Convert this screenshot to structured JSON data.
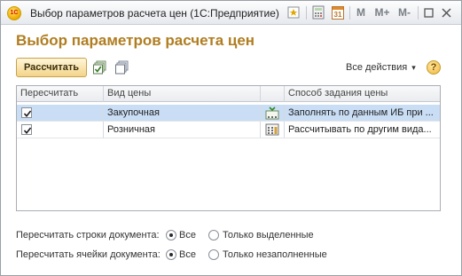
{
  "window": {
    "title": "Выбор параметров расчета цен",
    "app_name": "(1С:Предприятие)",
    "logo_text": "1С",
    "toolbar": {
      "calendar_day": "31",
      "mem_m": "M",
      "mem_m_plus": "M+",
      "mem_m_minus": "M-",
      "minimize": "_",
      "maximize": "□",
      "close": "✕"
    }
  },
  "page": {
    "title": "Выбор параметров расчета цен"
  },
  "toolbar": {
    "calculate_label": "Рассчитать",
    "all_actions_label": "Все действия",
    "all_actions_arrow": "▾",
    "help_label": "?"
  },
  "table": {
    "columns": {
      "recalc": "Пересчитать",
      "price_type": "Вид цены",
      "icon": "",
      "method": "Способ задания цены"
    },
    "rows": [
      {
        "checked": true,
        "price_type": "Закупочная",
        "method": "Заполнять по данным ИБ при ...",
        "selected": true
      },
      {
        "checked": true,
        "price_type": "Розничная",
        "method": "Рассчитывать по другим вида...",
        "selected": false
      }
    ]
  },
  "options": {
    "doc_rows": {
      "label": "Пересчитать строки документа:",
      "choice_all": "Все",
      "choice_other": "Только выделенные",
      "selected": "all"
    },
    "doc_cells": {
      "label": "Пересчитать ячейки документа:",
      "choice_all": "Все",
      "choice_other": "Только незаполненные",
      "selected": "all"
    }
  },
  "colors": {
    "title_accent": "#b07d20",
    "selected_row": "#c9ddf5",
    "button_fill": "#f3d489"
  }
}
